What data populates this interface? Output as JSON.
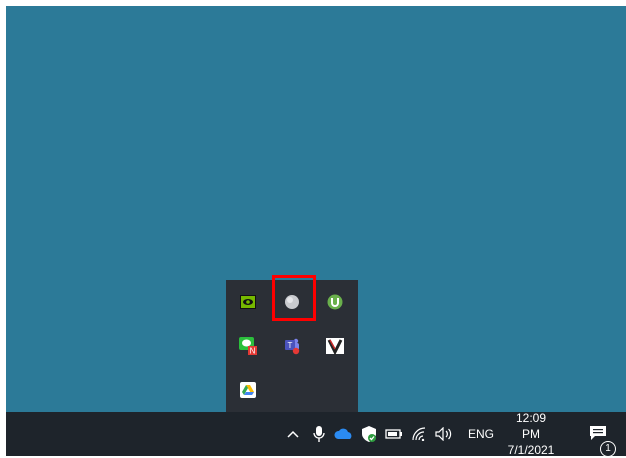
{
  "tray": {
    "icons": [
      "nvidia-icon",
      "globe-icon",
      "utorrent-icon",
      "chat-icon",
      "teams-icon",
      "vs-icon",
      "google-drive-icon"
    ]
  },
  "taskbar": {
    "language": "ENG",
    "time": "12:09 PM",
    "date": "7/1/2021",
    "notification_count": "1"
  }
}
